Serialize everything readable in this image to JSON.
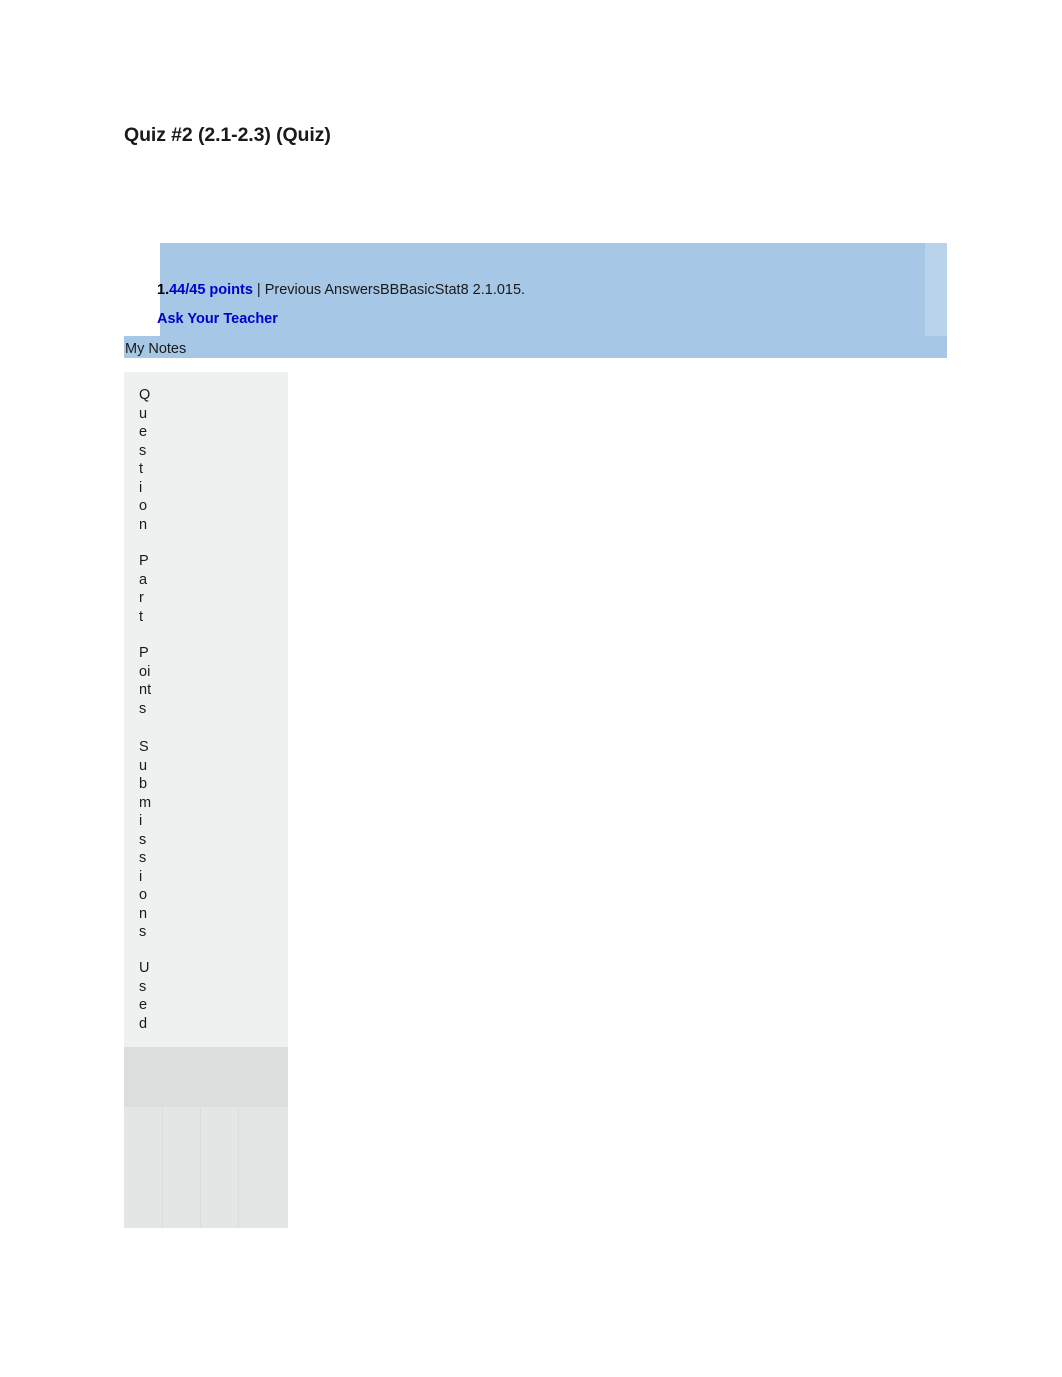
{
  "page": {
    "title": "Quiz #2 (2.1-2.3) (Quiz)"
  },
  "question_banner": {
    "number": "1.",
    "points": "44/45 points",
    "details": " | Previous AnswersBBBasicStat8 2.1.015.",
    "ask_your_teacher": "Ask Your Teacher",
    "background_color": "#a6c7e5",
    "link_color": "#0000cc"
  },
  "my_notes": {
    "label": "My Notes"
  },
  "grading_table": {
    "headers": [
      {
        "key": "question",
        "label": "Question",
        "stacked": "Q\nu\ne\ns\nt\ni\no\nn"
      },
      {
        "key": "part",
        "label": "Part",
        "stacked": "P\na\nr\nt"
      },
      {
        "key": "points",
        "label": "Points",
        "stacked": "P\noi\nnt\ns"
      },
      {
        "key": "submissions",
        "label": "Submissions",
        "stacked": "S\nu\nb\nm\ni\ns\ns\ni\no\nn\ns"
      },
      {
        "key": "used",
        "label": "Used",
        "stacked": "U\ns\ne\nd"
      }
    ],
    "rows": [],
    "header_background": "#eff0f0",
    "body_background": "#e3e4e4"
  }
}
